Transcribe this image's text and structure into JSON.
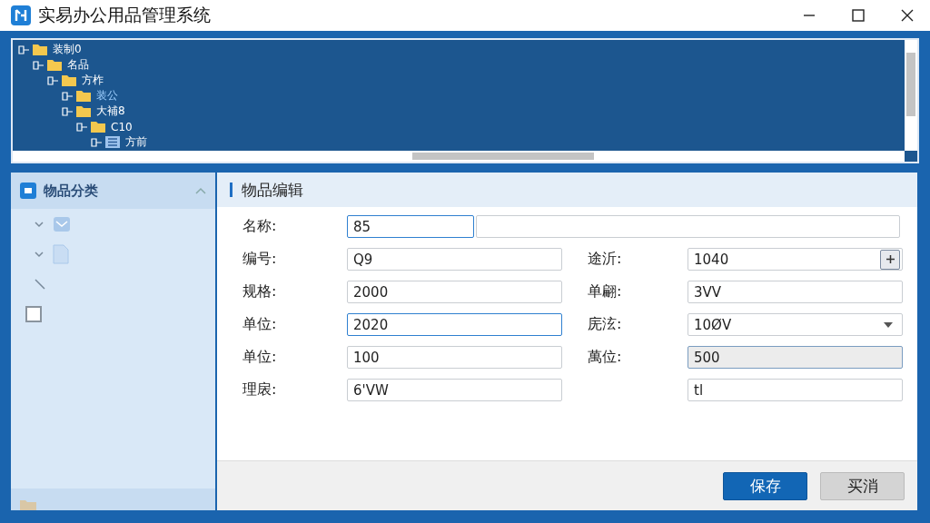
{
  "window": {
    "title": "实易办公用品管理系统"
  },
  "tree": [
    {
      "label": "装制0",
      "kind": "folder",
      "selected": false,
      "children": [
        {
          "label": "名品",
          "kind": "folder",
          "selected": false,
          "children": [
            {
              "label": "方柞",
              "kind": "folder",
              "selected": false,
              "children": [
                {
                  "label": "装公",
                  "kind": "folder",
                  "selected": true
                },
                {
                  "label": "大補8",
                  "kind": "folder",
                  "selected": false,
                  "children": [
                    {
                      "label": "C10",
                      "kind": "folder",
                      "selected": false,
                      "children": [
                        {
                          "label": "方前",
                          "kind": "list",
                          "selected": false
                        }
                      ]
                    }
                  ]
                }
              ]
            }
          ]
        }
      ]
    }
  ],
  "sidebar": {
    "title": "物品分类",
    "items": [
      {
        "kind": "envelope"
      },
      {
        "kind": "document"
      },
      {
        "kind": "pen"
      },
      {
        "kind": "checkbox",
        "checked": false
      }
    ]
  },
  "editor": {
    "title": "物品编辑",
    "rows": [
      {
        "label": "名称:",
        "value": "85",
        "focused": true,
        "right": {
          "kind": "wide"
        }
      },
      {
        "label": "编号:",
        "value": "Q9",
        "focused": false,
        "right": {
          "label": "途沂:",
          "value": "1040",
          "kind": "spin"
        }
      },
      {
        "label": "规格:",
        "value": "2000",
        "focused": false,
        "right": {
          "label": "单翩:",
          "value": "3VV",
          "kind": "text"
        }
      },
      {
        "label": "单位:",
        "value": "2020",
        "focused": true,
        "right": {
          "label": "庑泫:",
          "value": "10ØV",
          "kind": "select"
        }
      },
      {
        "label": "单位:",
        "value": "100",
        "focused": false,
        "right": {
          "label": "萬位:",
          "value": "500",
          "kind": "readonly"
        }
      },
      {
        "label": "理扆:",
        "value": "6'VW",
        "focused": false,
        "right": {
          "value": "tl",
          "kind": "text"
        }
      }
    ]
  },
  "buttons": [
    {
      "label": "保存",
      "primary": true
    },
    {
      "label": "买消",
      "primary": false
    }
  ]
}
